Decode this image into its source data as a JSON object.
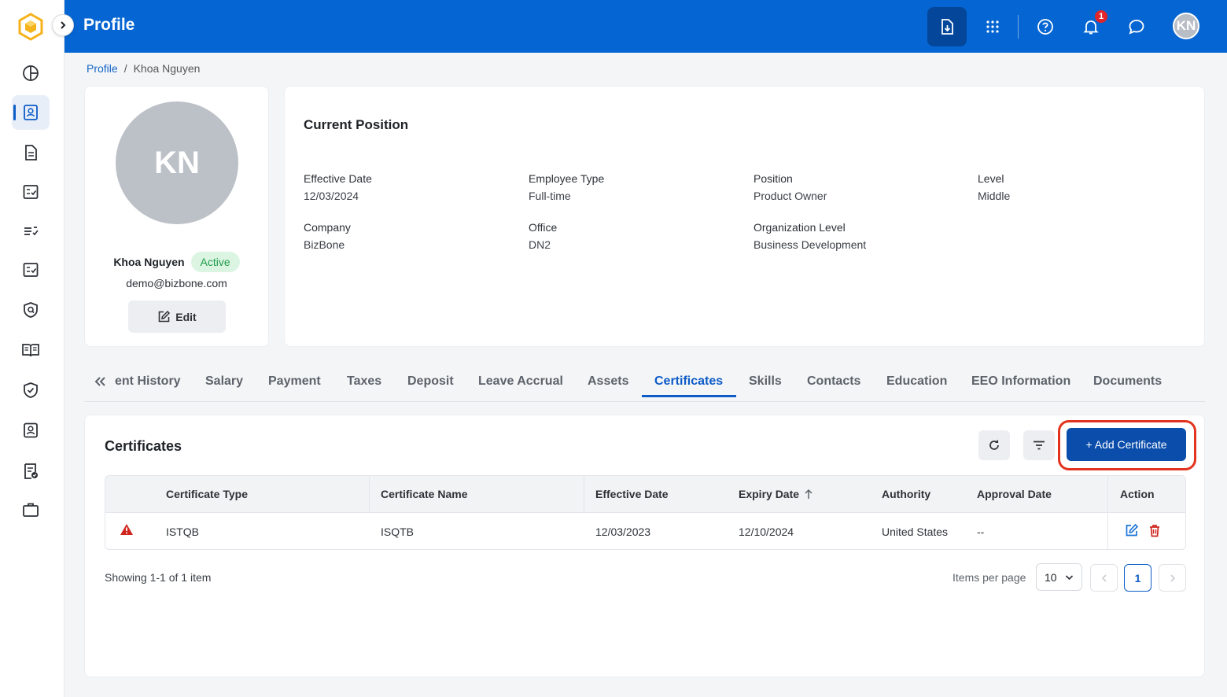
{
  "header": {
    "title": "Profile",
    "notification_count": "1",
    "user_initials": "KN"
  },
  "breadcrumb": {
    "parent": "Profile",
    "separator": "/",
    "current": "Khoa Nguyen"
  },
  "profile": {
    "initials": "KN",
    "name": "Khoa Nguyen",
    "status": "Active",
    "email": "demo@bizbone.com",
    "edit_label": "Edit"
  },
  "position": {
    "title": "Current Position",
    "fields": [
      {
        "label": "Effective Date",
        "value": "12/03/2024"
      },
      {
        "label": "Employee Type",
        "value": "Full-time"
      },
      {
        "label": "Position",
        "value": "Product Owner"
      },
      {
        "label": "Level",
        "value": "Middle"
      },
      {
        "label": "Company",
        "value": "BizBone"
      },
      {
        "label": "Office",
        "value": "DN2"
      },
      {
        "label": "Organization Level",
        "value": "Business Development"
      }
    ]
  },
  "tabs": [
    "ent History",
    "Salary",
    "Payment",
    "Taxes",
    "Deposit",
    "Leave Accrual",
    "Assets",
    "Certificates",
    "Skills",
    "Contacts",
    "Education",
    "EEO Information",
    "Documents"
  ],
  "active_tab": "Certificates",
  "certificates": {
    "title": "Certificates",
    "add_label": "+ Add Certificate",
    "columns": [
      "Certificate Type",
      "Certificate Name",
      "Effective Date",
      "Expiry Date",
      "Authority",
      "Approval Date",
      "Action"
    ],
    "rows": [
      {
        "type": "ISTQB",
        "name": "ISQTB",
        "effective_date": "12/03/2023",
        "expiry_date": "12/10/2024",
        "authority": "United States",
        "approval_date": "--"
      }
    ],
    "showing": "Showing 1-1 of 1 item",
    "items_per_page_label": "Items per page",
    "items_per_page": "10",
    "current_page": "1"
  },
  "colors": {
    "topbar": "#0565d2",
    "primary": "#0a4dab",
    "active_tab": "#0d5cc7",
    "highlight_ring": "#e2331e",
    "status_green": "#1f9d4a",
    "warning_red": "#d0251f"
  }
}
